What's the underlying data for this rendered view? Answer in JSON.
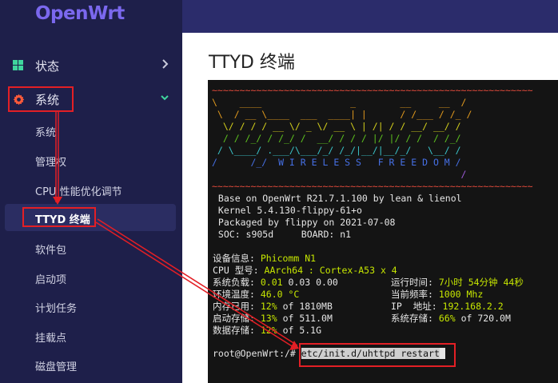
{
  "logo": "OpenWrt",
  "sidebar": {
    "status": "状态",
    "system": "系统",
    "items": [
      {
        "label": "系统"
      },
      {
        "label": "管理权"
      },
      {
        "label": "CPU 性能优化调节"
      },
      {
        "label": "TTYD 终端"
      },
      {
        "label": "软件包"
      },
      {
        "label": "启动项"
      },
      {
        "label": "计划任务"
      },
      {
        "label": "挂载点"
      },
      {
        "label": "磁盘管理"
      }
    ]
  },
  "page_title": "TTYD 终端",
  "terminal": {
    "tilde_line": "~~~~~~~~~~~~~~~~~~~~~~~~~~~~~~~~~~~~~~~~~~~~~~~~~~~~~~~~~~",
    "banner": [
      "\\    ____                _        __     __  /",
      " \\  / __ \\____  ___  ____| |      / /___ / /_ /",
      "  \\/ / / / __ \\/ _ \\/ __ \\ | /| / / __/ __/ /",
      "  / / /_/ / /_/ /  __/ / / / |/ |/ / /  / /_/",
      " / \\____/ .___/\\___/_/ /_/|__/|__/_/   \\__/ /",
      "/      /_/  W I R E L E S S   F R E E D O M /",
      "                                             /"
    ],
    "info": [
      " Base on OpenWrt R21.7.1.100 by lean & lienol",
      " Kernel 5.4.130-flippy-61+o",
      " Packaged by flippy on 2021-07-08",
      " SOC: s905d     BOARD: n1"
    ],
    "device_label": "设备信息: ",
    "device_value": "Phicomm N1",
    "cpu_label": "CPU 型号: ",
    "cpu_value": "AArch64 : Cortex-A53 x 4",
    "load_label": "系统负载: ",
    "load_value1": "0.01",
    "load_rest": " 0.03 0.00",
    "uptime_label": "运行时间: ",
    "uptime_value": "7小时 54分钟 44秒",
    "temp_label": "环境温度: ",
    "temp_value": "46.0 °C",
    "freq_label": "当前频率: ",
    "freq_value": "1000 Mhz",
    "mem_label": "内存已用: ",
    "mem_pct": "12%",
    "mem_rest": " of 1810MB",
    "ip_label": "IP  地址: ",
    "ip_value": "192.168.2.2",
    "boot_label": "启动存储: ",
    "boot_pct": "13%",
    "boot_rest": " of 511.0M",
    "sys_label": "系统存储: ",
    "sys_pct": "66%",
    "sys_rest": " of 720.0M",
    "data_label": "数据存储: ",
    "data_pct": "12%",
    "data_rest": " of 5.1G",
    "prompt": "root@OpenWrt:/# ",
    "command": "etc/init.d/uhttpd restart"
  },
  "colors": {
    "sidebar_bg": "#1e1f4a",
    "logo": "#7b68ee",
    "accent_green": "#3fd69e",
    "gear": "#ff5a3a",
    "annotation": "#e31f25"
  }
}
